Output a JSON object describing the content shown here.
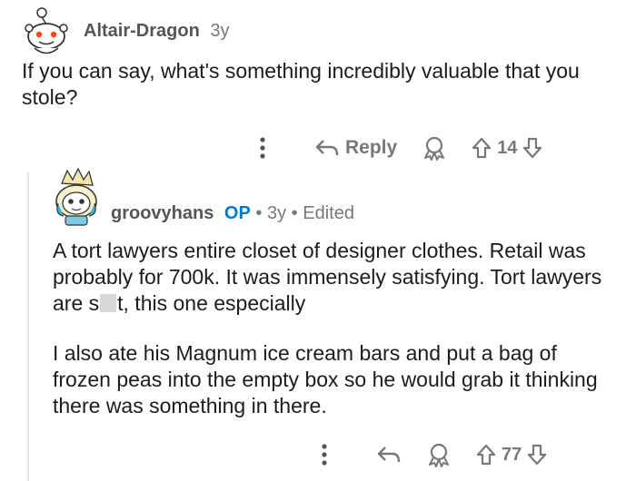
{
  "comment": {
    "username": "Altair-Dragon",
    "age": "3y",
    "body": "If you can say, what's something incredibly valuable that you stole?",
    "actions": {
      "more_icon": "dots-vertical-icon",
      "reply_label": "Reply",
      "award_icon": "award-icon",
      "upvote_count": "14"
    }
  },
  "reply": {
    "username": "groovyhans",
    "op_badge": "OP",
    "separator": "•",
    "age": "3y",
    "edited": "Edited",
    "paragraph1_before": "A tort lawyers entire closet of designer clothes. Retail was probably for 700k. It was immensely satisfying. Tort lawyers are s",
    "paragraph1_after": "t, this one especially",
    "paragraph2": "I also ate his Magnum ice cream bars and put a bag of frozen peas into the empty box so he would grab it thinking there was something in there.",
    "actions": {
      "upvote_count": "77"
    }
  }
}
